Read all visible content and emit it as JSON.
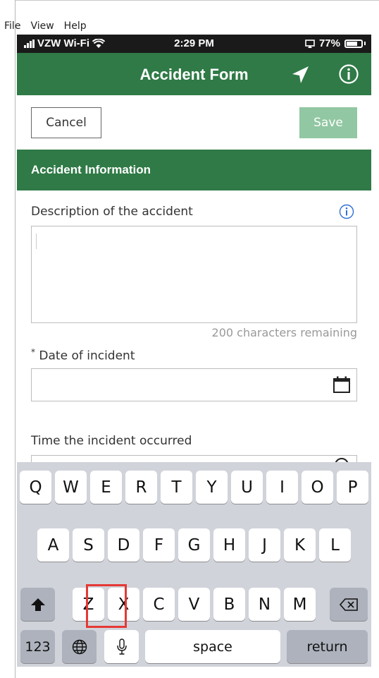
{
  "menu": [
    "File",
    "View",
    "Help"
  ],
  "status": {
    "carrier": "VZW Wi-Fi",
    "time": "2:29 PM",
    "battery": "77%",
    "battery_level": 0.77
  },
  "nav": {
    "title": "Accident Form",
    "location_icon": "location-arrow-icon",
    "info_icon": "info-icon"
  },
  "toolbar": {
    "cancel_label": "Cancel",
    "save_label": "Save"
  },
  "section": {
    "title": "Accident Information"
  },
  "form": {
    "description_label": "Description of the accident",
    "description_value": "",
    "chars_remaining": "200 characters remaining",
    "date_required_marker": "*",
    "date_label": "Date of incident",
    "date_value": "",
    "time_label": "Time the incident occurred"
  },
  "keyboard": {
    "row1": [
      "Q",
      "W",
      "E",
      "R",
      "T",
      "Y",
      "U",
      "I",
      "O",
      "P"
    ],
    "row2": [
      "A",
      "S",
      "D",
      "F",
      "G",
      "H",
      "J",
      "K",
      "L"
    ],
    "row3": [
      "Z",
      "X",
      "C",
      "V",
      "B",
      "N",
      "M"
    ],
    "numbers_key": "123",
    "space_key": "space",
    "return_key": "return"
  },
  "colors": {
    "header_green": "#2f7a46",
    "save_disabled": "#91c7a2",
    "highlight": "#e53935"
  }
}
